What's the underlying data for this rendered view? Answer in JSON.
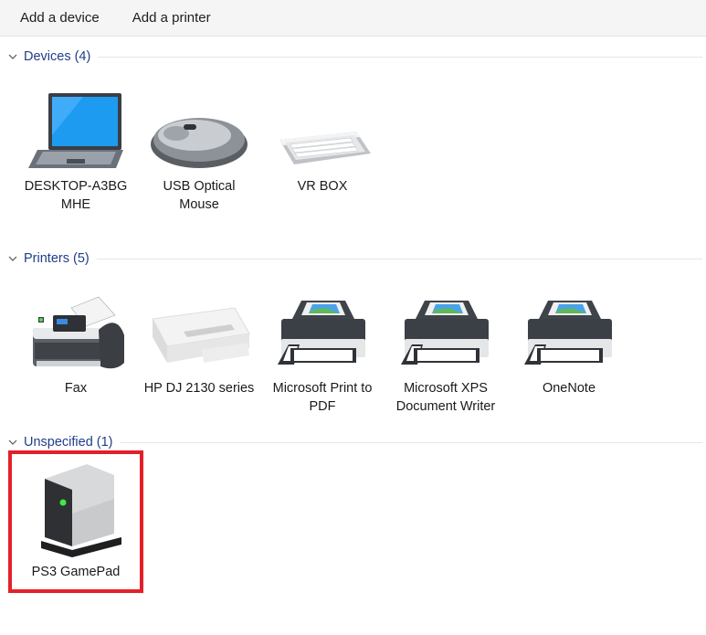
{
  "toolbar": {
    "add_device": "Add a device",
    "add_printer": "Add a printer"
  },
  "groups": {
    "devices": {
      "title": "Devices (4)",
      "items": [
        {
          "label_line1": "DESKTOP-A3BG",
          "label_line2": "MHE",
          "icon": "laptop-icon"
        },
        {
          "label_line1": "USB Optical",
          "label_line2": "Mouse",
          "icon": "mouse-icon"
        },
        {
          "label_line1": "VR BOX",
          "label_line2": "",
          "icon": "keyboard-icon"
        }
      ]
    },
    "printers": {
      "title": "Printers (5)",
      "items": [
        {
          "label_line1": "Fax",
          "label_line2": "",
          "icon": "fax-icon"
        },
        {
          "label_line1": "HP DJ 2130 series",
          "label_line2": "",
          "icon": "printer-icon"
        },
        {
          "label_line1": "Microsoft Print to",
          "label_line2": "PDF",
          "icon": "printer-icon"
        },
        {
          "label_line1": "Microsoft XPS",
          "label_line2": "Document Writer",
          "icon": "printer-icon"
        },
        {
          "label_line1": "OneNote",
          "label_line2": "",
          "icon": "printer-icon"
        }
      ]
    },
    "unspecified": {
      "title": "Unspecified (1)",
      "items": [
        {
          "label_line1": "PS3 GamePad",
          "label_line2": "",
          "icon": "device-tower-icon"
        }
      ]
    }
  },
  "colors": {
    "group_title": "#1f3d8a",
    "highlight": "#e3202a",
    "toolbar_bg": "#f5f5f5"
  }
}
